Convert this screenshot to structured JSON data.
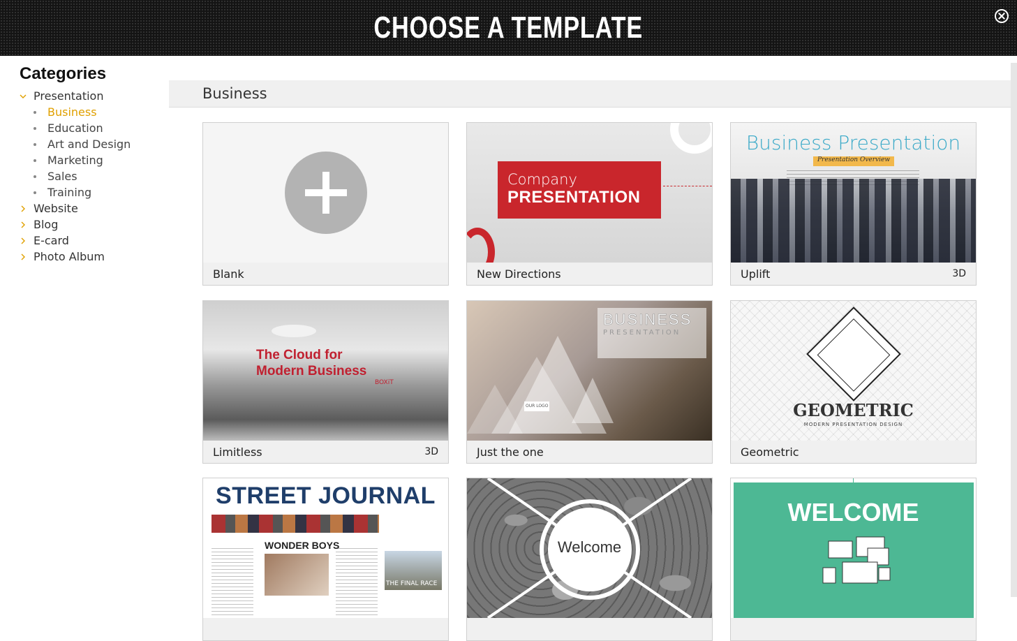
{
  "header": {
    "title": "CHOOSE A TEMPLATE",
    "close_icon": "close-circle-icon"
  },
  "sidebar": {
    "title": "Categories",
    "categories": [
      {
        "label": "Presentation",
        "expanded": true,
        "children": [
          "Business",
          "Education",
          "Art and Design",
          "Marketing",
          "Sales",
          "Training"
        ],
        "active_child": "Business"
      },
      {
        "label": "Website",
        "expanded": false
      },
      {
        "label": "Blog",
        "expanded": false
      },
      {
        "label": "E-card",
        "expanded": false
      },
      {
        "label": "Photo Album",
        "expanded": false
      }
    ]
  },
  "main": {
    "section_title": "Business",
    "templates": [
      {
        "name": "Blank",
        "badge": ""
      },
      {
        "name": "New Directions",
        "badge": "",
        "thumb": {
          "line1": "Company",
          "line2": "PRESENTATION"
        }
      },
      {
        "name": "Uplift",
        "badge": "3D",
        "thumb": {
          "title": "Business Presentation",
          "subtitle": "Presentation Overview"
        }
      },
      {
        "name": "Limitless",
        "badge": "3D",
        "thumb": {
          "line1": "The Cloud for",
          "line2": "Modern Business",
          "brand": "BOXiT"
        }
      },
      {
        "name": "Just the one",
        "badge": "",
        "thumb": {
          "line1": "BUSINESS",
          "line2": "PRESENTATION",
          "logo": "OUR LOGO"
        }
      },
      {
        "name": "Geometric",
        "badge": "",
        "thumb": {
          "title": "GEOMETRIC",
          "subtitle": "MODERN PRESENTATION DESIGN"
        }
      },
      {
        "name": "",
        "badge": "",
        "thumb": {
          "title": "STREET JOURNAL",
          "headline": "WONDER BOYS",
          "caption": "THE FINAL RACE"
        }
      },
      {
        "name": "",
        "badge": "",
        "thumb": {
          "title": "Welcome"
        }
      },
      {
        "name": "",
        "badge": "",
        "thumb": {
          "title": "WELCOME"
        }
      }
    ]
  },
  "colors": {
    "accent": "#e0a000",
    "header_bg": "#141414",
    "red": "#c9262c"
  }
}
